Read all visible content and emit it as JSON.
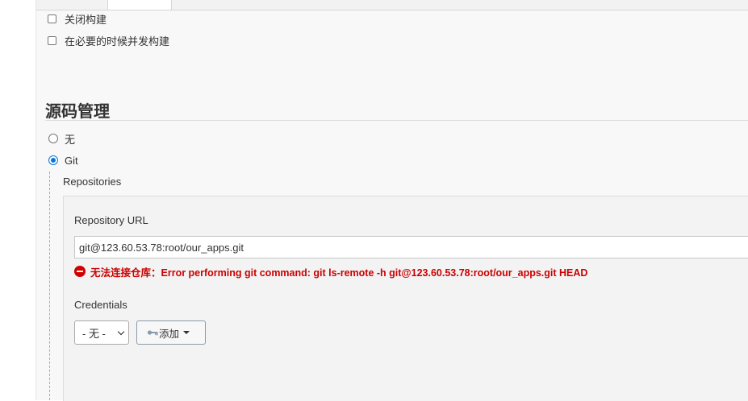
{
  "tabs": [
    "",
    "",
    "",
    "",
    ""
  ],
  "options": {
    "disable_build": "关闭构建",
    "concurrent_build": "在必要的时候并发构建"
  },
  "scm": {
    "title": "源码管理",
    "radio_none": "无",
    "radio_git": "Git",
    "selected": "Git"
  },
  "repositories": {
    "label": "Repositories",
    "url_label": "Repository URL",
    "url_value": "git@123.60.53.78:root/our_apps.git",
    "error": "无法连接仓库：Error performing git command: git ls-remote -h git@123.60.53.78:root/our_apps.git HEAD",
    "credentials_label": "Credentials",
    "credentials_value": "- 无 -",
    "add_label": "添加"
  },
  "colors": {
    "error": "#cc0000",
    "accent": "#0b75d8"
  },
  "icons": [
    "error-icon",
    "key-icon",
    "caret-down-icon",
    "chevron-down-icon"
  ]
}
